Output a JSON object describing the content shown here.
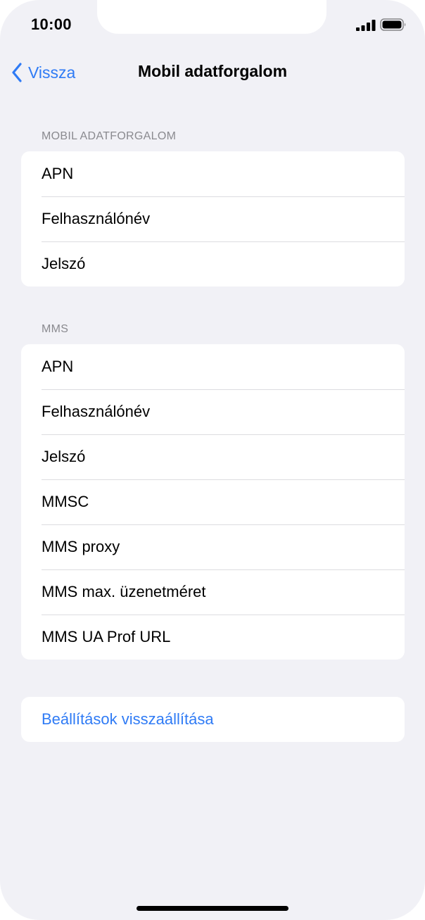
{
  "status_bar": {
    "time": "10:00"
  },
  "nav": {
    "back_label": "Vissza",
    "title": "Mobil adatforgalom"
  },
  "sections": {
    "mobile_data": {
      "header": "MOBIL ADATFORGALOM",
      "rows": [
        "APN",
        "Felhasználónév",
        "Jelszó"
      ]
    },
    "mms": {
      "header": "MMS",
      "rows": [
        "APN",
        "Felhasználónév",
        "Jelszó",
        "MMSC",
        "MMS proxy",
        "MMS max. üzenetméret",
        "MMS UA Prof URL"
      ]
    },
    "reset": {
      "label": "Beállítások visszaállítása"
    }
  },
  "colors": {
    "accent": "#2f7bf5",
    "background": "#f1f1f6",
    "section_header": "#8a8a8f"
  },
  "icons": {
    "back": "chevron-left-icon",
    "signal": "cellular-signal-icon",
    "battery": "battery-icon"
  }
}
